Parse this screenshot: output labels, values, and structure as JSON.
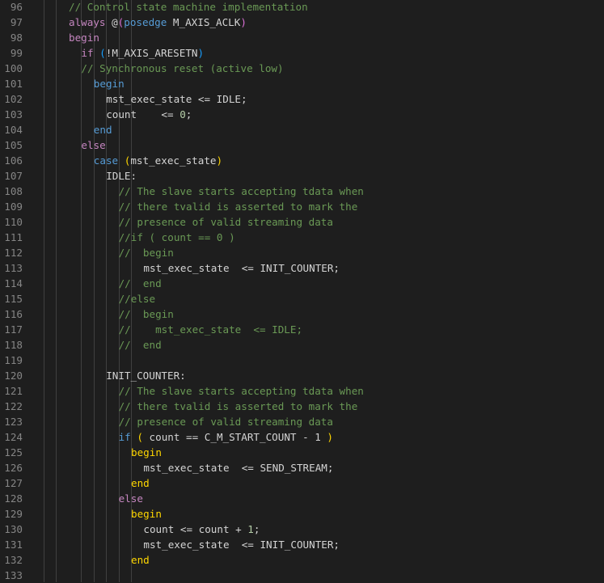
{
  "editor": {
    "lines": [
      {
        "n": "96",
        "indent": 1,
        "tokens": [
          [
            "// Control state machine implementation",
            "comment"
          ]
        ]
      },
      {
        "n": "97",
        "indent": 1,
        "tokens": [
          [
            "always",
            "ctrl"
          ],
          [
            " @",
            "op"
          ],
          [
            "(",
            "paren2"
          ],
          [
            "posedge",
            "kw"
          ],
          [
            " M_AXIS_ACLK",
            "sig"
          ],
          [
            ")",
            "paren2"
          ]
        ]
      },
      {
        "n": "98",
        "indent": 1,
        "tokens": [
          [
            "begin",
            "ctrl"
          ]
        ]
      },
      {
        "n": "99",
        "indent": 2,
        "tokens": [
          [
            "if",
            "ctrl"
          ],
          [
            " ",
            "op"
          ],
          [
            "(",
            "paren3"
          ],
          [
            "!M_AXIS_ARESETN",
            "sig"
          ],
          [
            ")",
            "paren3"
          ]
        ]
      },
      {
        "n": "100",
        "indent": 2,
        "tokens": [
          [
            "// Synchronous reset (active low)",
            "comment"
          ]
        ]
      },
      {
        "n": "101",
        "indent": 3,
        "tokens": [
          [
            "begin",
            "kw"
          ]
        ]
      },
      {
        "n": "102",
        "indent": 4,
        "tokens": [
          [
            "mst_exec_state <= IDLE;",
            "sig"
          ]
        ]
      },
      {
        "n": "103",
        "indent": 4,
        "tokens": [
          [
            "count    <= ",
            "sig"
          ],
          [
            "0",
            "num"
          ],
          [
            ";",
            "op"
          ]
        ]
      },
      {
        "n": "104",
        "indent": 3,
        "tokens": [
          [
            "end",
            "kw"
          ]
        ]
      },
      {
        "n": "105",
        "indent": 2,
        "tokens": [
          [
            "else",
            "ctrl"
          ]
        ]
      },
      {
        "n": "106",
        "indent": 3,
        "tokens": [
          [
            "case",
            "kw"
          ],
          [
            " ",
            "op"
          ],
          [
            "(",
            "paren1"
          ],
          [
            "mst_exec_state",
            "sig"
          ],
          [
            ")",
            "paren1"
          ]
        ]
      },
      {
        "n": "107",
        "indent": 4,
        "tokens": [
          [
            "IDLE:",
            "sig"
          ]
        ]
      },
      {
        "n": "108",
        "indent": 5,
        "tokens": [
          [
            "// The slave starts accepting tdata when",
            "comment"
          ]
        ]
      },
      {
        "n": "109",
        "indent": 5,
        "tokens": [
          [
            "// there tvalid is asserted to mark the",
            "comment"
          ]
        ]
      },
      {
        "n": "110",
        "indent": 5,
        "tokens": [
          [
            "// presence of valid streaming data",
            "comment"
          ]
        ]
      },
      {
        "n": "111",
        "indent": 5,
        "tokens": [
          [
            "//if ( count == 0 )",
            "comment"
          ]
        ]
      },
      {
        "n": "112",
        "indent": 5,
        "tokens": [
          [
            "//  begin",
            "comment"
          ]
        ]
      },
      {
        "n": "113",
        "indent": 7,
        "tokens": [
          [
            "mst_exec_state  <= INIT_COUNTER;",
            "sig"
          ]
        ]
      },
      {
        "n": "114",
        "indent": 5,
        "tokens": [
          [
            "//  end",
            "comment"
          ]
        ]
      },
      {
        "n": "115",
        "indent": 5,
        "tokens": [
          [
            "//else",
            "comment"
          ]
        ]
      },
      {
        "n": "116",
        "indent": 5,
        "tokens": [
          [
            "//  begin",
            "comment"
          ]
        ]
      },
      {
        "n": "117",
        "indent": 5,
        "tokens": [
          [
            "//    mst_exec_state  <= IDLE;",
            "comment"
          ]
        ]
      },
      {
        "n": "118",
        "indent": 5,
        "tokens": [
          [
            "//  end",
            "comment"
          ]
        ]
      },
      {
        "n": "119",
        "indent": 0,
        "tokens": []
      },
      {
        "n": "120",
        "indent": 4,
        "tokens": [
          [
            "INIT_COUNTER:",
            "sig"
          ]
        ]
      },
      {
        "n": "121",
        "indent": 5,
        "tokens": [
          [
            "// The slave starts accepting tdata when",
            "comment"
          ]
        ]
      },
      {
        "n": "122",
        "indent": 5,
        "tokens": [
          [
            "// there tvalid is asserted to mark the",
            "comment"
          ]
        ]
      },
      {
        "n": "123",
        "indent": 5,
        "tokens": [
          [
            "// presence of valid streaming data",
            "comment"
          ]
        ]
      },
      {
        "n": "124",
        "indent": 5,
        "tokens": [
          [
            "if",
            "kw"
          ],
          [
            " ",
            "op"
          ],
          [
            "(",
            "paren1"
          ],
          [
            " count == C_M_START_COUNT - 1 ",
            "sig"
          ],
          [
            ")",
            "paren1"
          ]
        ]
      },
      {
        "n": "125",
        "indent": 6,
        "tokens": [
          [
            "begin",
            "paren1"
          ]
        ]
      },
      {
        "n": "126",
        "indent": 7,
        "tokens": [
          [
            "mst_exec_state  <= SEND_STREAM;",
            "sig"
          ]
        ]
      },
      {
        "n": "127",
        "indent": 6,
        "tokens": [
          [
            "end",
            "paren1"
          ]
        ]
      },
      {
        "n": "128",
        "indent": 5,
        "tokens": [
          [
            "else",
            "ctrl"
          ]
        ]
      },
      {
        "n": "129",
        "indent": 6,
        "tokens": [
          [
            "begin",
            "paren1"
          ]
        ]
      },
      {
        "n": "130",
        "indent": 7,
        "tokens": [
          [
            "count <= count + ",
            "sig"
          ],
          [
            "1",
            "num"
          ],
          [
            ";",
            "op"
          ]
        ]
      },
      {
        "n": "131",
        "indent": 7,
        "tokens": [
          [
            "mst_exec_state  <= INIT_COUNTER;",
            "sig"
          ]
        ]
      },
      {
        "n": "132",
        "indent": 6,
        "tokens": [
          [
            "end",
            "paren1"
          ]
        ]
      },
      {
        "n": "133",
        "indent": 0,
        "tokens": []
      }
    ]
  }
}
